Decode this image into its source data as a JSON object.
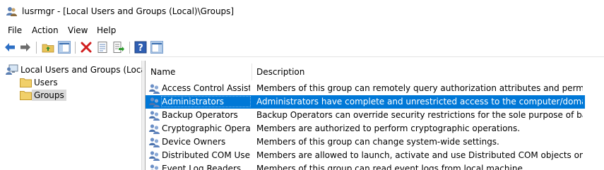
{
  "window": {
    "title": "lusrmgr - [Local Users and Groups (Local)\\Groups]"
  },
  "menu": {
    "items": [
      "File",
      "Action",
      "View",
      "Help"
    ]
  },
  "toolbar": {
    "buttons": [
      "back-icon",
      "forward-icon",
      "up-folder-icon",
      "show-hide-tree-icon",
      "delete-icon",
      "properties-icon",
      "export-list-icon",
      "help-icon",
      "show-hide-action-pane-icon"
    ]
  },
  "tree": {
    "root_label": "Local Users and Groups (Local)",
    "children": [
      {
        "label": "Users"
      },
      {
        "label": "Groups",
        "selected": true
      }
    ]
  },
  "list": {
    "columns": [
      "Name",
      "Description"
    ],
    "rows": [
      {
        "name": "Access Control Assist...",
        "description": "Members of this group can remotely query authorization attributes and permissions f..."
      },
      {
        "name": "Administrators",
        "description": "Administrators have complete and unrestricted access to the computer/domain",
        "selected": true
      },
      {
        "name": "Backup Operators",
        "description": "Backup Operators can override security restrictions for the sole purpose of backing u..."
      },
      {
        "name": "Cryptographic Operat...",
        "description": "Members are authorized to perform cryptographic operations."
      },
      {
        "name": "Device Owners",
        "description": "Members of this group can change system-wide settings."
      },
      {
        "name": "Distributed COM Users",
        "description": "Members are allowed to launch, activate and use Distributed COM objects on this ma..."
      },
      {
        "name": "Event Log Readers",
        "description": "Members of this group can read event logs from local machine"
      }
    ]
  },
  "colors": {
    "selection": "#0078d7",
    "tree_selection": "#d9d9d9"
  }
}
